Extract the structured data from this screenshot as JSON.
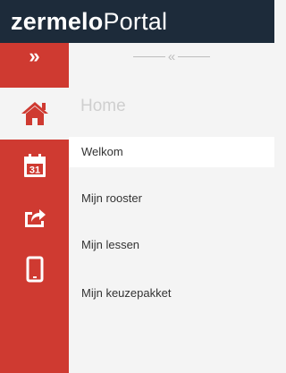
{
  "app": {
    "logo_bold": "zermelo",
    "logo_light": "Portal"
  },
  "colors": {
    "header_bg": "#1d2b3a",
    "rail_bg": "#cf3a31",
    "content_bg": "#f4f4f4",
    "active_item_bg": "#ffffff"
  },
  "rail": {
    "toggle_glyph": "»",
    "items": [
      {
        "icon": "home-icon",
        "active": true
      },
      {
        "icon": "calendar-icon",
        "text": "31",
        "active": false
      },
      {
        "icon": "share-icon",
        "active": false
      },
      {
        "icon": "tablet-icon",
        "active": false
      }
    ]
  },
  "collapse": {
    "glyph": "«"
  },
  "section": {
    "title": "Home"
  },
  "menu": {
    "items": [
      {
        "label": "Welkom",
        "active": true
      },
      {
        "label": "Mijn rooster",
        "active": false
      },
      {
        "label": "Mijn lessen",
        "active": false
      },
      {
        "label": "Mijn keuzepakket",
        "active": false
      }
    ]
  }
}
